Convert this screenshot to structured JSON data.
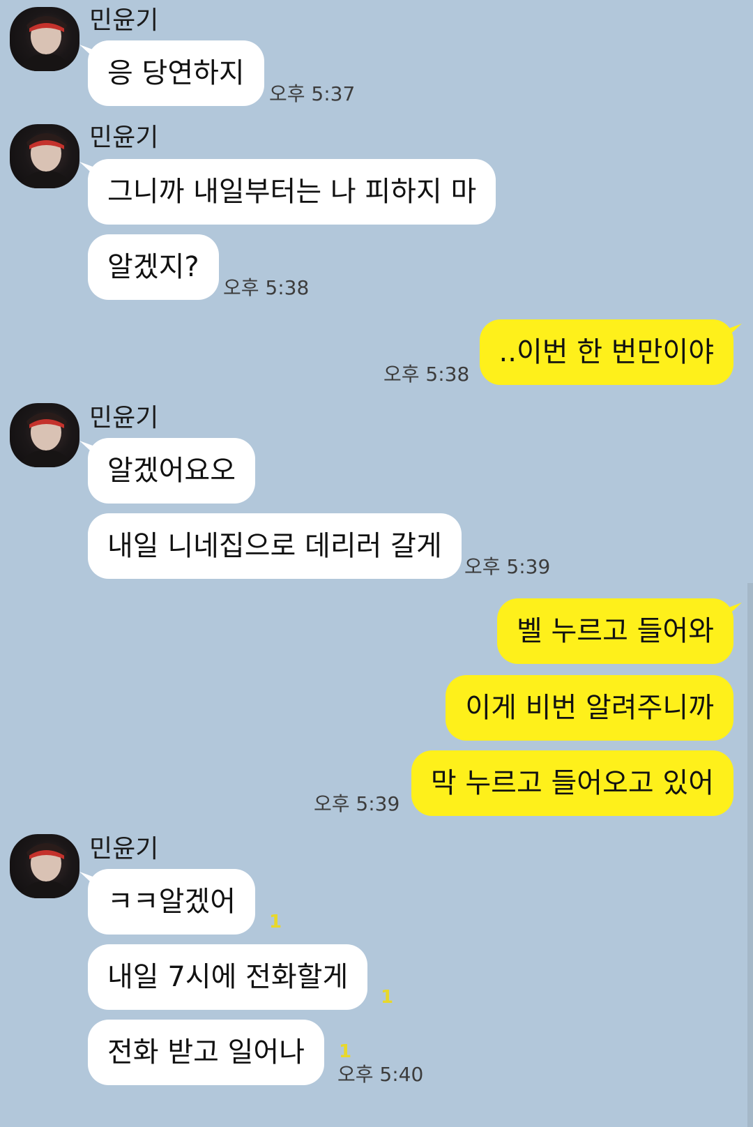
{
  "sender_name": "민윤기",
  "accent_colors": {
    "outgoing": "#fef01b",
    "incoming": "#ffffff",
    "background": "#b2c7da",
    "unread": "#e8d82a"
  },
  "messages": [
    {
      "text": "응 당연하지",
      "time": "오후 5:37"
    },
    {
      "text": "그니까 내일부터는 나 피하지 마"
    },
    {
      "text": "알겠지?",
      "time": "오후 5:38"
    },
    {
      "text": "..이번 한 번만이야",
      "time": "오후 5:38"
    },
    {
      "text": "알겠어요오"
    },
    {
      "text": "내일 니네집으로 데리러 갈게",
      "time": "오후 5:39"
    },
    {
      "text": "벨 누르고 들어와"
    },
    {
      "text": "이게 비번 알려주니까"
    },
    {
      "text": "막 누르고 들어오고 있어",
      "time": "오후 5:39"
    },
    {
      "text": "ㅋㅋ알겠어",
      "unread": "1"
    },
    {
      "text": "내일 7시에 전화할게",
      "unread": "1"
    },
    {
      "text": "전화 받고 일어나",
      "unread": "1",
      "time": "오후 5:40"
    }
  ]
}
